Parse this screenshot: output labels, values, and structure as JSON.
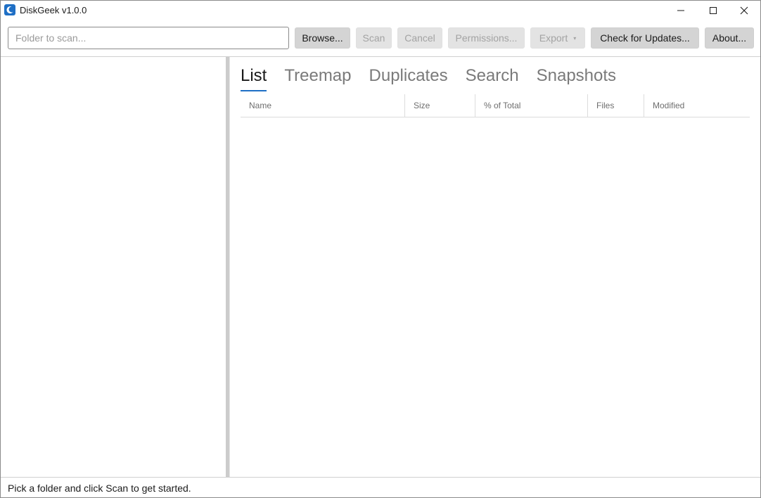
{
  "window": {
    "title": "DiskGeek v1.0.0",
    "icon": "app-moon-icon",
    "accent_color": "#1f6fc5"
  },
  "toolbar": {
    "folder_placeholder": "Folder to scan...",
    "folder_value": "",
    "browse_label": "Browse...",
    "scan_label": "Scan",
    "cancel_label": "Cancel",
    "permissions_label": "Permissions...",
    "export_label": "Export",
    "export_caret": "▾",
    "updates_label": "Check for Updates...",
    "about_label": "About..."
  },
  "tabs": [
    {
      "label": "List",
      "active": true
    },
    {
      "label": "Treemap",
      "active": false
    },
    {
      "label": "Duplicates",
      "active": false
    },
    {
      "label": "Search",
      "active": false
    },
    {
      "label": "Snapshots",
      "active": false
    }
  ],
  "table": {
    "columns": [
      "Name",
      "Size",
      "% of Total",
      "Files",
      "Modified"
    ],
    "rows": []
  },
  "status": {
    "text": "Pick a folder and click Scan to get started."
  }
}
